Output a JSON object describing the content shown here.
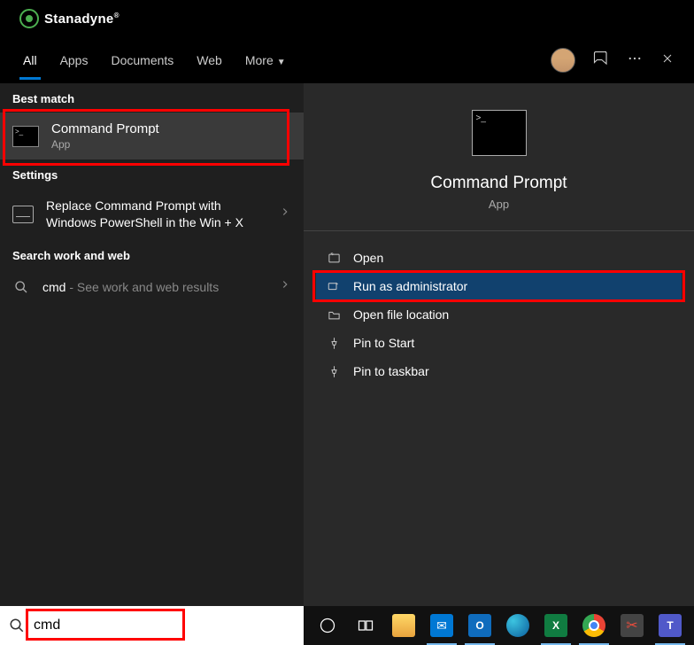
{
  "brand": {
    "name": "Stanadyne"
  },
  "tabs": [
    "All",
    "Apps",
    "Documents",
    "Web",
    "More"
  ],
  "activeTab": "All",
  "sections": {
    "bestMatch": {
      "title": "Best match"
    },
    "settings": {
      "title": "Settings"
    },
    "searchWork": {
      "title": "Search work and web"
    }
  },
  "bestMatch": {
    "title": "Command Prompt",
    "sub": "App"
  },
  "settingsItem": {
    "title": "Replace Command Prompt with Windows PowerShell in the Win + X"
  },
  "webItem": {
    "prefix": "cmd",
    "suffix": " - See work and web results"
  },
  "preview": {
    "title": "Command Prompt",
    "sub": "App"
  },
  "actions": {
    "open": "Open",
    "runAdmin": "Run as administrator",
    "openLoc": "Open file location",
    "pinStart": "Pin to Start",
    "pinTaskbar": "Pin to taskbar"
  },
  "search": {
    "value": "cmd"
  },
  "colors": {
    "accent": "#0078d4",
    "highlight": "#11416e",
    "annotation": "#f00"
  }
}
